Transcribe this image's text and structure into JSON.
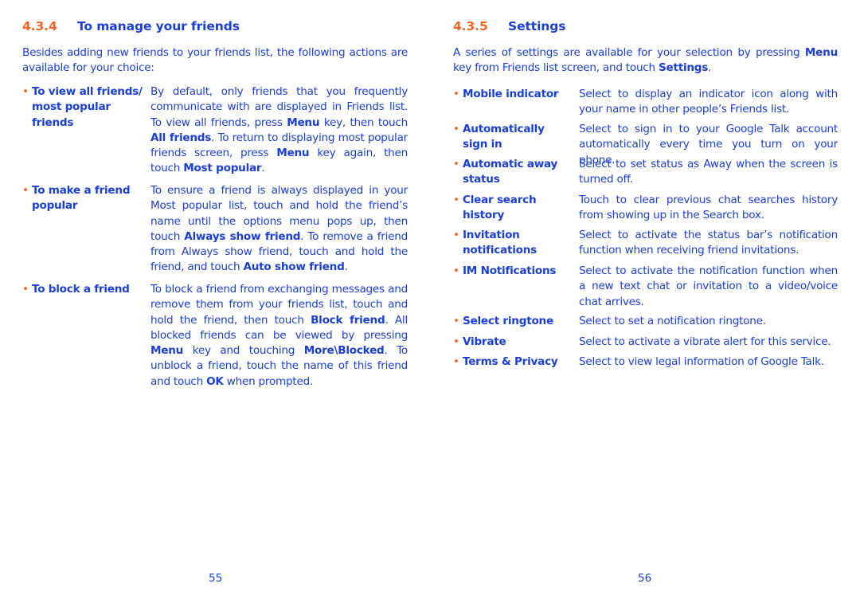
{
  "left_page": {
    "section_number": "4.3.4",
    "section_title": "To manage your friends",
    "intro": "Besides adding new friends to your friends list, the following actions are available for your choice:",
    "items": [
      {
        "label_line1": "To view all friends/",
        "label_line2": "most popular",
        "label_line3": "friends",
        "desc": [
          {
            "t": "By default, only friends that you frequently communicate with are displayed in Friends list. To view all friends, press "
          },
          {
            "b": "Menu"
          },
          {
            "t": " key, then touch "
          },
          {
            "b": "All friends"
          },
          {
            "t": ". To return to displaying most popular friends screen, press "
          },
          {
            "b": "Menu"
          },
          {
            "t": " key again, then touch "
          },
          {
            "b": "Most popular"
          },
          {
            "t": "."
          }
        ]
      },
      {
        "label_line1": "To make a friend",
        "label_line2": "popular",
        "desc": [
          {
            "t": "To ensure a friend is always displayed in your Most popular list, touch and hold the friend’s name until the options menu pops up, then touch "
          },
          {
            "b": "Always show friend"
          },
          {
            "t": ". To remove a friend from Always show friend, touch and hold the friend, and touch "
          },
          {
            "b": "Auto show friend"
          },
          {
            "t": "."
          }
        ]
      },
      {
        "label_line1": "To block a friend",
        "desc": [
          {
            "t": "To block a friend from exchanging messages and remove them from your friends list, touch and hold the friend, then touch "
          },
          {
            "b": "Block friend"
          },
          {
            "t": ". All blocked friends can be viewed by pressing "
          },
          {
            "b": "Menu"
          },
          {
            "t": " key and touching "
          },
          {
            "b": "More\\Blocked"
          },
          {
            "t": ". To unblock a friend, touch the name of this friend and touch "
          },
          {
            "b": "OK"
          },
          {
            "t": " when prompted."
          }
        ]
      }
    ],
    "page_number": "55"
  },
  "right_page": {
    "section_number": "4.3.5",
    "section_title": "Settings",
    "intro_parts": [
      {
        "t": "A series of settings are available for your selection by pressing "
      },
      {
        "b": "Menu"
      },
      {
        "t": " key from Friends list screen, and touch "
      },
      {
        "b": "Settings"
      },
      {
        "t": "."
      }
    ],
    "items": [
      {
        "label_line1": "Mobile indicator",
        "desc": "Select to display an indicator icon along with your name in other people’s Friends list."
      },
      {
        "label_line1": "Automatically",
        "label_line2": "sign in",
        "desc": "Select to sign in to your Google Talk account automatically every time you turn on your phone."
      },
      {
        "label_line1": "Automatic away",
        "label_line2": "status",
        "desc": "Select to set status as Away when the screen is turned off."
      },
      {
        "label_line1": "Clear search",
        "label_line2": "history",
        "desc": "Touch to clear previous chat searches history from showing up in the Search box."
      },
      {
        "label_line1": "Invitation",
        "label_line2": "notifications",
        "desc": "Select to activate the status bar’s notification function when receiving friend invitations."
      },
      {
        "label_line1": "IM Notifications",
        "desc": "Select to activate the notification function when a new text chat or invitation to a video/voice chat arrives."
      },
      {
        "label_line1": "Select ringtone",
        "desc": "Select to set a notification ringtone."
      },
      {
        "label_line1": "Vibrate",
        "desc": "Select to activate a vibrate alert for this service."
      },
      {
        "label_line1": "Terms & Privacy",
        "desc": "Select to view legal information of Google Talk."
      }
    ],
    "page_number": "56"
  },
  "bullet_glyph": "•",
  "colors": {
    "text": "#1a3fd6",
    "accent": "#f26522"
  }
}
